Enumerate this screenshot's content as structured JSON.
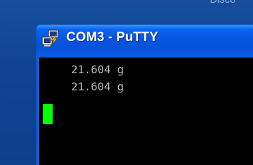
{
  "desktop": {
    "background_text": "Disco"
  },
  "window": {
    "title": "COM3 - PuTTY",
    "icon": "putty-app-icon"
  },
  "terminal": {
    "lines": [
      "21.604 g",
      "21.604 g"
    ],
    "cursor_color": "#00ff00",
    "background_color": "#000000",
    "text_color": "#bbbbbb"
  }
}
